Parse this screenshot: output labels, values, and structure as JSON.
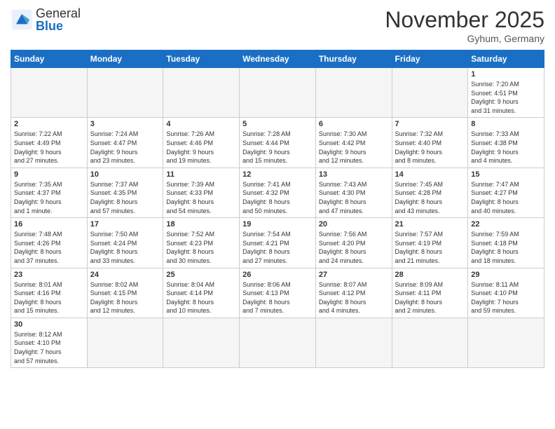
{
  "logo": {
    "text_general": "General",
    "text_blue": "Blue"
  },
  "header": {
    "month": "November 2025",
    "location": "Gyhum, Germany"
  },
  "weekdays": [
    "Sunday",
    "Monday",
    "Tuesday",
    "Wednesday",
    "Thursday",
    "Friday",
    "Saturday"
  ],
  "weeks": [
    [
      {
        "day": "",
        "info": "",
        "empty": true
      },
      {
        "day": "",
        "info": "",
        "empty": true
      },
      {
        "day": "",
        "info": "",
        "empty": true
      },
      {
        "day": "",
        "info": "",
        "empty": true
      },
      {
        "day": "",
        "info": "",
        "empty": true
      },
      {
        "day": "",
        "info": "",
        "empty": true
      },
      {
        "day": "1",
        "info": "Sunrise: 7:20 AM\nSunset: 4:51 PM\nDaylight: 9 hours\nand 31 minutes."
      }
    ],
    [
      {
        "day": "2",
        "info": "Sunrise: 7:22 AM\nSunset: 4:49 PM\nDaylight: 9 hours\nand 27 minutes."
      },
      {
        "day": "3",
        "info": "Sunrise: 7:24 AM\nSunset: 4:47 PM\nDaylight: 9 hours\nand 23 minutes."
      },
      {
        "day": "4",
        "info": "Sunrise: 7:26 AM\nSunset: 4:46 PM\nDaylight: 9 hours\nand 19 minutes."
      },
      {
        "day": "5",
        "info": "Sunrise: 7:28 AM\nSunset: 4:44 PM\nDaylight: 9 hours\nand 15 minutes."
      },
      {
        "day": "6",
        "info": "Sunrise: 7:30 AM\nSunset: 4:42 PM\nDaylight: 9 hours\nand 12 minutes."
      },
      {
        "day": "7",
        "info": "Sunrise: 7:32 AM\nSunset: 4:40 PM\nDaylight: 9 hours\nand 8 minutes."
      },
      {
        "day": "8",
        "info": "Sunrise: 7:33 AM\nSunset: 4:38 PM\nDaylight: 9 hours\nand 4 minutes."
      }
    ],
    [
      {
        "day": "9",
        "info": "Sunrise: 7:35 AM\nSunset: 4:37 PM\nDaylight: 9 hours\nand 1 minute."
      },
      {
        "day": "10",
        "info": "Sunrise: 7:37 AM\nSunset: 4:35 PM\nDaylight: 8 hours\nand 57 minutes."
      },
      {
        "day": "11",
        "info": "Sunrise: 7:39 AM\nSunset: 4:33 PM\nDaylight: 8 hours\nand 54 minutes."
      },
      {
        "day": "12",
        "info": "Sunrise: 7:41 AM\nSunset: 4:32 PM\nDaylight: 8 hours\nand 50 minutes."
      },
      {
        "day": "13",
        "info": "Sunrise: 7:43 AM\nSunset: 4:30 PM\nDaylight: 8 hours\nand 47 minutes."
      },
      {
        "day": "14",
        "info": "Sunrise: 7:45 AM\nSunset: 4:28 PM\nDaylight: 8 hours\nand 43 minutes."
      },
      {
        "day": "15",
        "info": "Sunrise: 7:47 AM\nSunset: 4:27 PM\nDaylight: 8 hours\nand 40 minutes."
      }
    ],
    [
      {
        "day": "16",
        "info": "Sunrise: 7:48 AM\nSunset: 4:26 PM\nDaylight: 8 hours\nand 37 minutes."
      },
      {
        "day": "17",
        "info": "Sunrise: 7:50 AM\nSunset: 4:24 PM\nDaylight: 8 hours\nand 33 minutes."
      },
      {
        "day": "18",
        "info": "Sunrise: 7:52 AM\nSunset: 4:23 PM\nDaylight: 8 hours\nand 30 minutes."
      },
      {
        "day": "19",
        "info": "Sunrise: 7:54 AM\nSunset: 4:21 PM\nDaylight: 8 hours\nand 27 minutes."
      },
      {
        "day": "20",
        "info": "Sunrise: 7:56 AM\nSunset: 4:20 PM\nDaylight: 8 hours\nand 24 minutes."
      },
      {
        "day": "21",
        "info": "Sunrise: 7:57 AM\nSunset: 4:19 PM\nDaylight: 8 hours\nand 21 minutes."
      },
      {
        "day": "22",
        "info": "Sunrise: 7:59 AM\nSunset: 4:18 PM\nDaylight: 8 hours\nand 18 minutes."
      }
    ],
    [
      {
        "day": "23",
        "info": "Sunrise: 8:01 AM\nSunset: 4:16 PM\nDaylight: 8 hours\nand 15 minutes."
      },
      {
        "day": "24",
        "info": "Sunrise: 8:02 AM\nSunset: 4:15 PM\nDaylight: 8 hours\nand 12 minutes."
      },
      {
        "day": "25",
        "info": "Sunrise: 8:04 AM\nSunset: 4:14 PM\nDaylight: 8 hours\nand 10 minutes."
      },
      {
        "day": "26",
        "info": "Sunrise: 8:06 AM\nSunset: 4:13 PM\nDaylight: 8 hours\nand 7 minutes."
      },
      {
        "day": "27",
        "info": "Sunrise: 8:07 AM\nSunset: 4:12 PM\nDaylight: 8 hours\nand 4 minutes."
      },
      {
        "day": "28",
        "info": "Sunrise: 8:09 AM\nSunset: 4:11 PM\nDaylight: 8 hours\nand 2 minutes."
      },
      {
        "day": "29",
        "info": "Sunrise: 8:11 AM\nSunset: 4:10 PM\nDaylight: 7 hours\nand 59 minutes."
      }
    ],
    [
      {
        "day": "30",
        "info": "Sunrise: 8:12 AM\nSunset: 4:10 PM\nDaylight: 7 hours\nand 57 minutes.",
        "last": true
      },
      {
        "day": "",
        "info": "",
        "empty": true,
        "last": true
      },
      {
        "day": "",
        "info": "",
        "empty": true,
        "last": true
      },
      {
        "day": "",
        "info": "",
        "empty": true,
        "last": true
      },
      {
        "day": "",
        "info": "",
        "empty": true,
        "last": true
      },
      {
        "day": "",
        "info": "",
        "empty": true,
        "last": true
      },
      {
        "day": "",
        "info": "",
        "empty": true,
        "last": true
      }
    ]
  ]
}
